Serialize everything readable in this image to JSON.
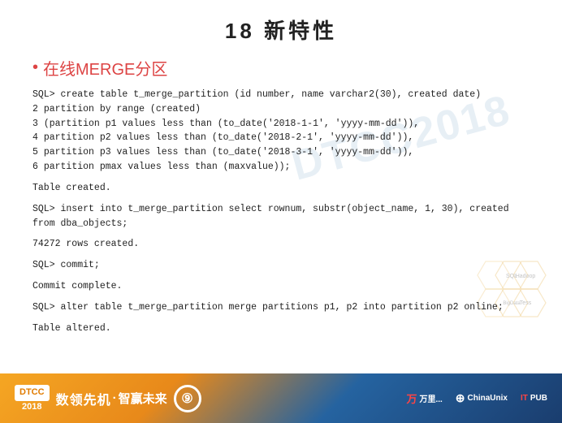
{
  "page": {
    "title": "18  新特性",
    "section_heading": "在线MERGE分区",
    "bullet": "•",
    "watermark": "DTCC2018"
  },
  "code_blocks": [
    {
      "id": "create_table",
      "lines": [
        {
          "prefix": "SQL> ",
          "text": "create table t_merge_partition (id number, name varchar2(30), created date)"
        },
        {
          "prefix": "  2  ",
          "text": "partition by range (created)"
        },
        {
          "prefix": "  3  ",
          "text": "(partition p1 values less than (to_date('2018-1-1', 'yyyy-mm-dd')),"
        },
        {
          "prefix": "  4  ",
          "text": " partition p2 values less than (to_date('2018-2-1', 'yyyy-mm-dd')),"
        },
        {
          "prefix": "  5  ",
          "text": " partition p3 values less than (to_date('2018-3-1', 'yyyy-mm-dd')),"
        },
        {
          "prefix": "  6  ",
          "text": " partition pmax values less than (maxvalue));"
        }
      ]
    }
  ],
  "results": [
    {
      "id": "table_created",
      "text": "Table created."
    },
    {
      "id": "insert_sql",
      "text": "SQL> insert into t_merge_partition select rownum, substr(object_name, 1, 30), created from dba_objects;"
    },
    {
      "id": "rows_created",
      "text": "74272 rows created."
    },
    {
      "id": "commit_sql",
      "text": "SQL> commit;"
    },
    {
      "id": "commit_complete",
      "text": "Commit complete."
    },
    {
      "id": "alter_sql_prefix",
      "text": "SQL> alter table t_merge_partition "
    },
    {
      "id": "alter_sql_suffix",
      "text": " partitions p1, p2 into partition p2 "
    },
    {
      "id": "alter_table_result",
      "text": "Table altered."
    }
  ],
  "alter_line": {
    "prefix": "SQL> alter table t_merge_partition ",
    "merge_keyword": "merge",
    "middle": " partitions p1, p2 into partition p2 ",
    "online_keyword": "online",
    "suffix": ";"
  },
  "bottom_bar": {
    "dtcc_label": "DTCC",
    "year": "2018",
    "slogan": "数领先机",
    "slogan2": "智赢未来",
    "gear_symbol": "⑨",
    "sponsors": [
      {
        "name": "万里开源",
        "label": "万里..."
      },
      {
        "name": "ChinaUnix",
        "label": "⊕ChinaUnix"
      },
      {
        "name": "ITPUB",
        "label": "IT PUB"
      }
    ]
  },
  "hex_labels": [
    "Hadoop",
    "SQL",
    "BigData",
    "Tess"
  ]
}
